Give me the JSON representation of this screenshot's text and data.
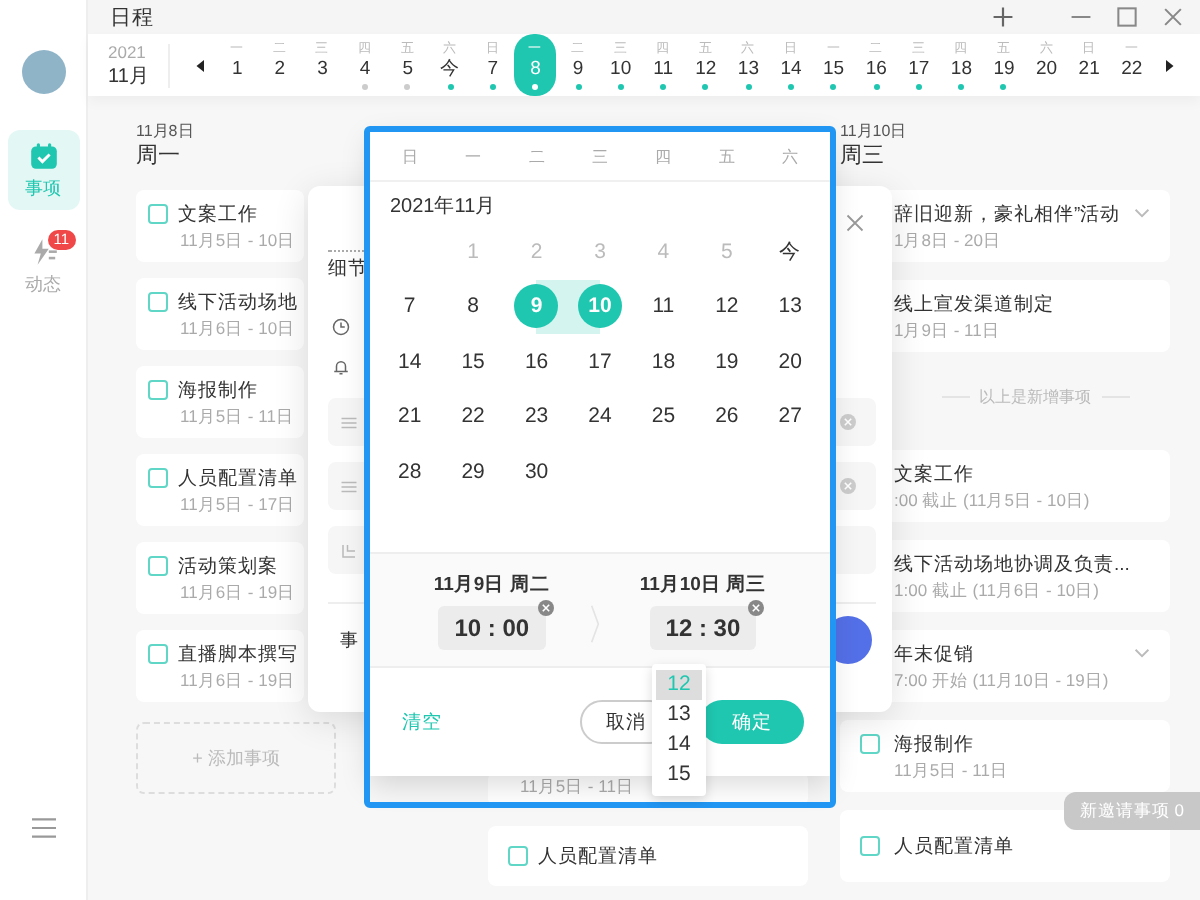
{
  "window": {
    "title": "日程"
  },
  "sidebar": {
    "items": [
      {
        "kind": "calendar",
        "label": "事项",
        "selected": true
      },
      {
        "kind": "activity",
        "label": "动态",
        "selected": false,
        "badge": "11"
      }
    ]
  },
  "week_strip": {
    "year": "2021",
    "month": "11月",
    "days": [
      {
        "weekday": "一",
        "date": "1",
        "selected": false
      },
      {
        "weekday": "二",
        "date": "2",
        "selected": false
      },
      {
        "weekday": "三",
        "date": "3",
        "selected": false
      },
      {
        "weekday": "四",
        "date": "4",
        "selected": false,
        "color": "#cccccc"
      },
      {
        "weekday": "五",
        "date": "5",
        "selected": false,
        "color": "#cccccc"
      },
      {
        "weekday": "六",
        "date": "今",
        "selected": false,
        "color": "#1fc7b0"
      },
      {
        "weekday": "日",
        "date": "7",
        "selected": false,
        "color": "#1fc7b0"
      },
      {
        "weekday": "一",
        "date": "8",
        "selected": true,
        "color": "#ffffff"
      },
      {
        "weekday": "二",
        "date": "9",
        "selected": false,
        "color": "#1fc7b0"
      },
      {
        "weekday": "三",
        "date": "10",
        "selected": false,
        "color": "#1fc7b0"
      },
      {
        "weekday": "四",
        "date": "11",
        "selected": false,
        "color": "#1fc7b0"
      },
      {
        "weekday": "五",
        "date": "12",
        "selected": false,
        "color": "#1fc7b0"
      },
      {
        "weekday": "六",
        "date": "13",
        "selected": false,
        "color": "#1fc7b0"
      },
      {
        "weekday": "日",
        "date": "14",
        "selected": false,
        "color": "#1fc7b0"
      },
      {
        "weekday": "一",
        "date": "15",
        "selected": false,
        "color": "#1fc7b0"
      },
      {
        "weekday": "二",
        "date": "16",
        "selected": false,
        "color": "#1fc7b0"
      },
      {
        "weekday": "三",
        "date": "17",
        "selected": false,
        "color": "#1fc7b0"
      },
      {
        "weekday": "四",
        "date": "18",
        "selected": false,
        "color": "#1fc7b0"
      },
      {
        "weekday": "五",
        "date": "19",
        "selected": false,
        "color": "#1fc7b0"
      },
      {
        "weekday": "六",
        "date": "20",
        "selected": false
      },
      {
        "weekday": "日",
        "date": "21",
        "selected": false
      },
      {
        "weekday": "一",
        "date": "22",
        "selected": false
      }
    ]
  },
  "left_column": {
    "date": "11月8日",
    "weekday": "周一",
    "tasks": [
      {
        "title": "文案工作",
        "dates": "11月5日 - 10日",
        "checked": false
      },
      {
        "title": "线下活动场地",
        "dates": "11月6日 - 10日",
        "checked": false
      },
      {
        "title": "海报制作",
        "dates": "11月5日 - 11日",
        "checked": false
      },
      {
        "title": "人员配置清单",
        "dates": "11月5日 - 17日",
        "checked": false
      },
      {
        "title": "活动策划案",
        "dates": "11月6日 - 19日",
        "checked": false
      },
      {
        "title": "直播脚本撰写",
        "dates": "11月6日 - 19日",
        "checked": false
      }
    ],
    "add_label": "+ 添加事项"
  },
  "middle_column": {
    "partial_dates": "11月5日 - 11日",
    "tasks": [
      {
        "title": "人员配置清单",
        "checked": false
      }
    ]
  },
  "right_column": {
    "date": "11月10日",
    "weekday": "周三",
    "tasks": [
      {
        "kind": "clipped",
        "title": "辞旧迎新，豪礼相伴”活动",
        "dates": "1月8日 - 20日",
        "expandable": true
      },
      {
        "kind": "clipped",
        "title": "线上宣发渠道制定",
        "dates": "1月9日 - 11日",
        "expandable": false
      },
      {
        "kind": "divider",
        "title": "以上是新增事项"
      },
      {
        "kind": "clipped",
        "title": "文案工作",
        "dates": ":00 截止 (11月5日 - 10日)",
        "expandable": false
      },
      {
        "kind": "clipped",
        "title": "线下活动场地协调及负责...",
        "dates": "1:00 截止 (11月6日 - 10日)",
        "expandable": false
      },
      {
        "kind": "clipped",
        "title": "年末促销",
        "dates": "7:00 开始 (11月10日 - 19日)",
        "expandable": true
      },
      {
        "kind": "task",
        "title": "海报制作",
        "dates": "11月5日 - 11日",
        "expandable": false,
        "checked": false
      },
      {
        "kind": "task",
        "title": "人员配置清单",
        "expandable": false,
        "checked": false
      }
    ]
  },
  "dialog": {
    "heading": "细节",
    "rows": [
      {
        "kind": "time"
      },
      {
        "kind": "reminder"
      },
      {
        "kind": "note",
        "clearable": true
      },
      {
        "kind": "note",
        "clearable": true
      },
      {
        "kind": "tag",
        "clearable": false
      }
    ],
    "footer_label": "事"
  },
  "date_picker": {
    "weekdays": [
      "日",
      "一",
      "二",
      "三",
      "四",
      "五",
      "六"
    ],
    "month_title": "2021年11月",
    "weeks": [
      [
        {
          "label": "1",
          "disabled": true,
          "selected": false
        },
        {
          "label": "2",
          "disabled": true,
          "selected": false
        },
        {
          "label": "3",
          "disabled": true,
          "selected": false
        },
        {
          "label": "4",
          "disabled": true,
          "selected": false
        },
        {
          "label": "5",
          "disabled": true,
          "selected": false
        },
        {
          "label": "今",
          "disabled": false,
          "selected": false
        }
      ],
      [
        {
          "label": "7",
          "disabled": false,
          "selected": false
        },
        {
          "label": "8",
          "disabled": false,
          "selected": false
        },
        {
          "label": "9",
          "disabled": false,
          "selected": true
        },
        {
          "label": "10",
          "disabled": false,
          "selected": true
        },
        {
          "label": "11",
          "disabled": false,
          "selected": false
        },
        {
          "label": "12",
          "disabled": false,
          "selected": false
        },
        {
          "label": "13",
          "disabled": false,
          "selected": false
        }
      ],
      [
        {
          "label": "14",
          "disabled": false,
          "selected": false
        },
        {
          "label": "15",
          "disabled": false,
          "selected": false
        },
        {
          "label": "16",
          "disabled": false,
          "selected": false
        },
        {
          "label": "17",
          "disabled": false,
          "selected": false
        },
        {
          "label": "18",
          "disabled": false,
          "selected": false
        },
        {
          "label": "19",
          "disabled": false,
          "selected": false
        },
        {
          "label": "20",
          "disabled": false,
          "selected": false
        }
      ],
      [
        {
          "label": "21",
          "disabled": false,
          "selected": false
        },
        {
          "label": "22",
          "disabled": false,
          "selected": false
        },
        {
          "label": "23",
          "disabled": false,
          "selected": false
        },
        {
          "label": "24",
          "disabled": false,
          "selected": false
        },
        {
          "label": "25",
          "disabled": false,
          "selected": false
        },
        {
          "label": "26",
          "disabled": false,
          "selected": false
        },
        {
          "label": "27",
          "disabled": false,
          "selected": false
        }
      ],
      [
        {
          "label": "28",
          "disabled": false,
          "selected": false
        },
        {
          "label": "29",
          "disabled": false,
          "selected": false
        },
        {
          "label": "30",
          "disabled": false,
          "selected": false
        }
      ]
    ],
    "start": {
      "date": "11月9日 周二",
      "time": "10 : 00"
    },
    "end": {
      "date": "11月10日 周三",
      "time": "12 : 30"
    },
    "hour_options": [
      {
        "label": "12",
        "selected": true
      },
      {
        "label": "13",
        "selected": false
      },
      {
        "label": "14",
        "selected": false
      },
      {
        "label": "15",
        "selected": false
      }
    ],
    "clear_label": "清空",
    "cancel_label": "取消",
    "confirm_label": "确定"
  },
  "toast": "新邀请事项 0"
}
